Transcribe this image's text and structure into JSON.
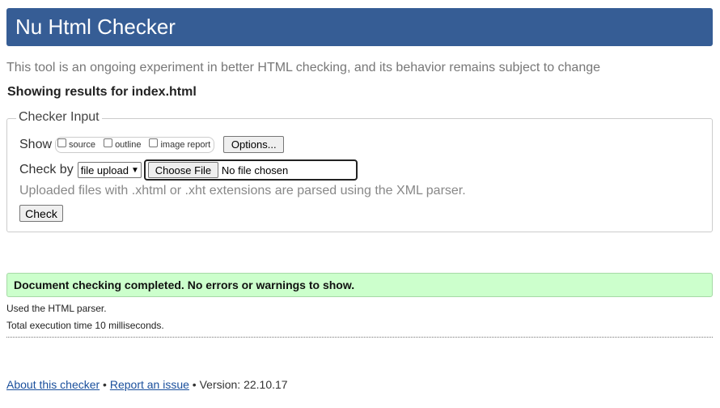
{
  "header": {
    "title": "Nu Html Checker"
  },
  "tagline": "This tool is an ongoing experiment in better HTML checking, and its behavior remains subject to change",
  "results_for": "Showing results for index.html",
  "checker_input": {
    "legend": "Checker Input",
    "show_label": "Show",
    "show_options": [
      {
        "label": "source",
        "checked": false
      },
      {
        "label": "outline",
        "checked": false
      },
      {
        "label": "image report",
        "checked": false
      }
    ],
    "options_button": "Options...",
    "check_by_label": "Check by",
    "check_by_selected": "file upload",
    "choose_file_button": "Choose File",
    "file_status": "No file chosen",
    "parser_note": "Uploaded files with .xhtml or .xht extensions are parsed using the XML parser.",
    "check_button": "Check"
  },
  "success_message": "Document checking completed. No errors or warnings to show.",
  "parser_used": "Used the HTML parser.",
  "execution_time": "Total execution time 10 milliseconds.",
  "footer": {
    "about_link": "About this checker",
    "sep1": " • ",
    "report_link": "Report an issue",
    "version": " • Version: 22.10.17"
  },
  "colors": {
    "header_bg": "#365d95",
    "success_bg": "#ccffcc",
    "link": "#1a4f9c"
  }
}
